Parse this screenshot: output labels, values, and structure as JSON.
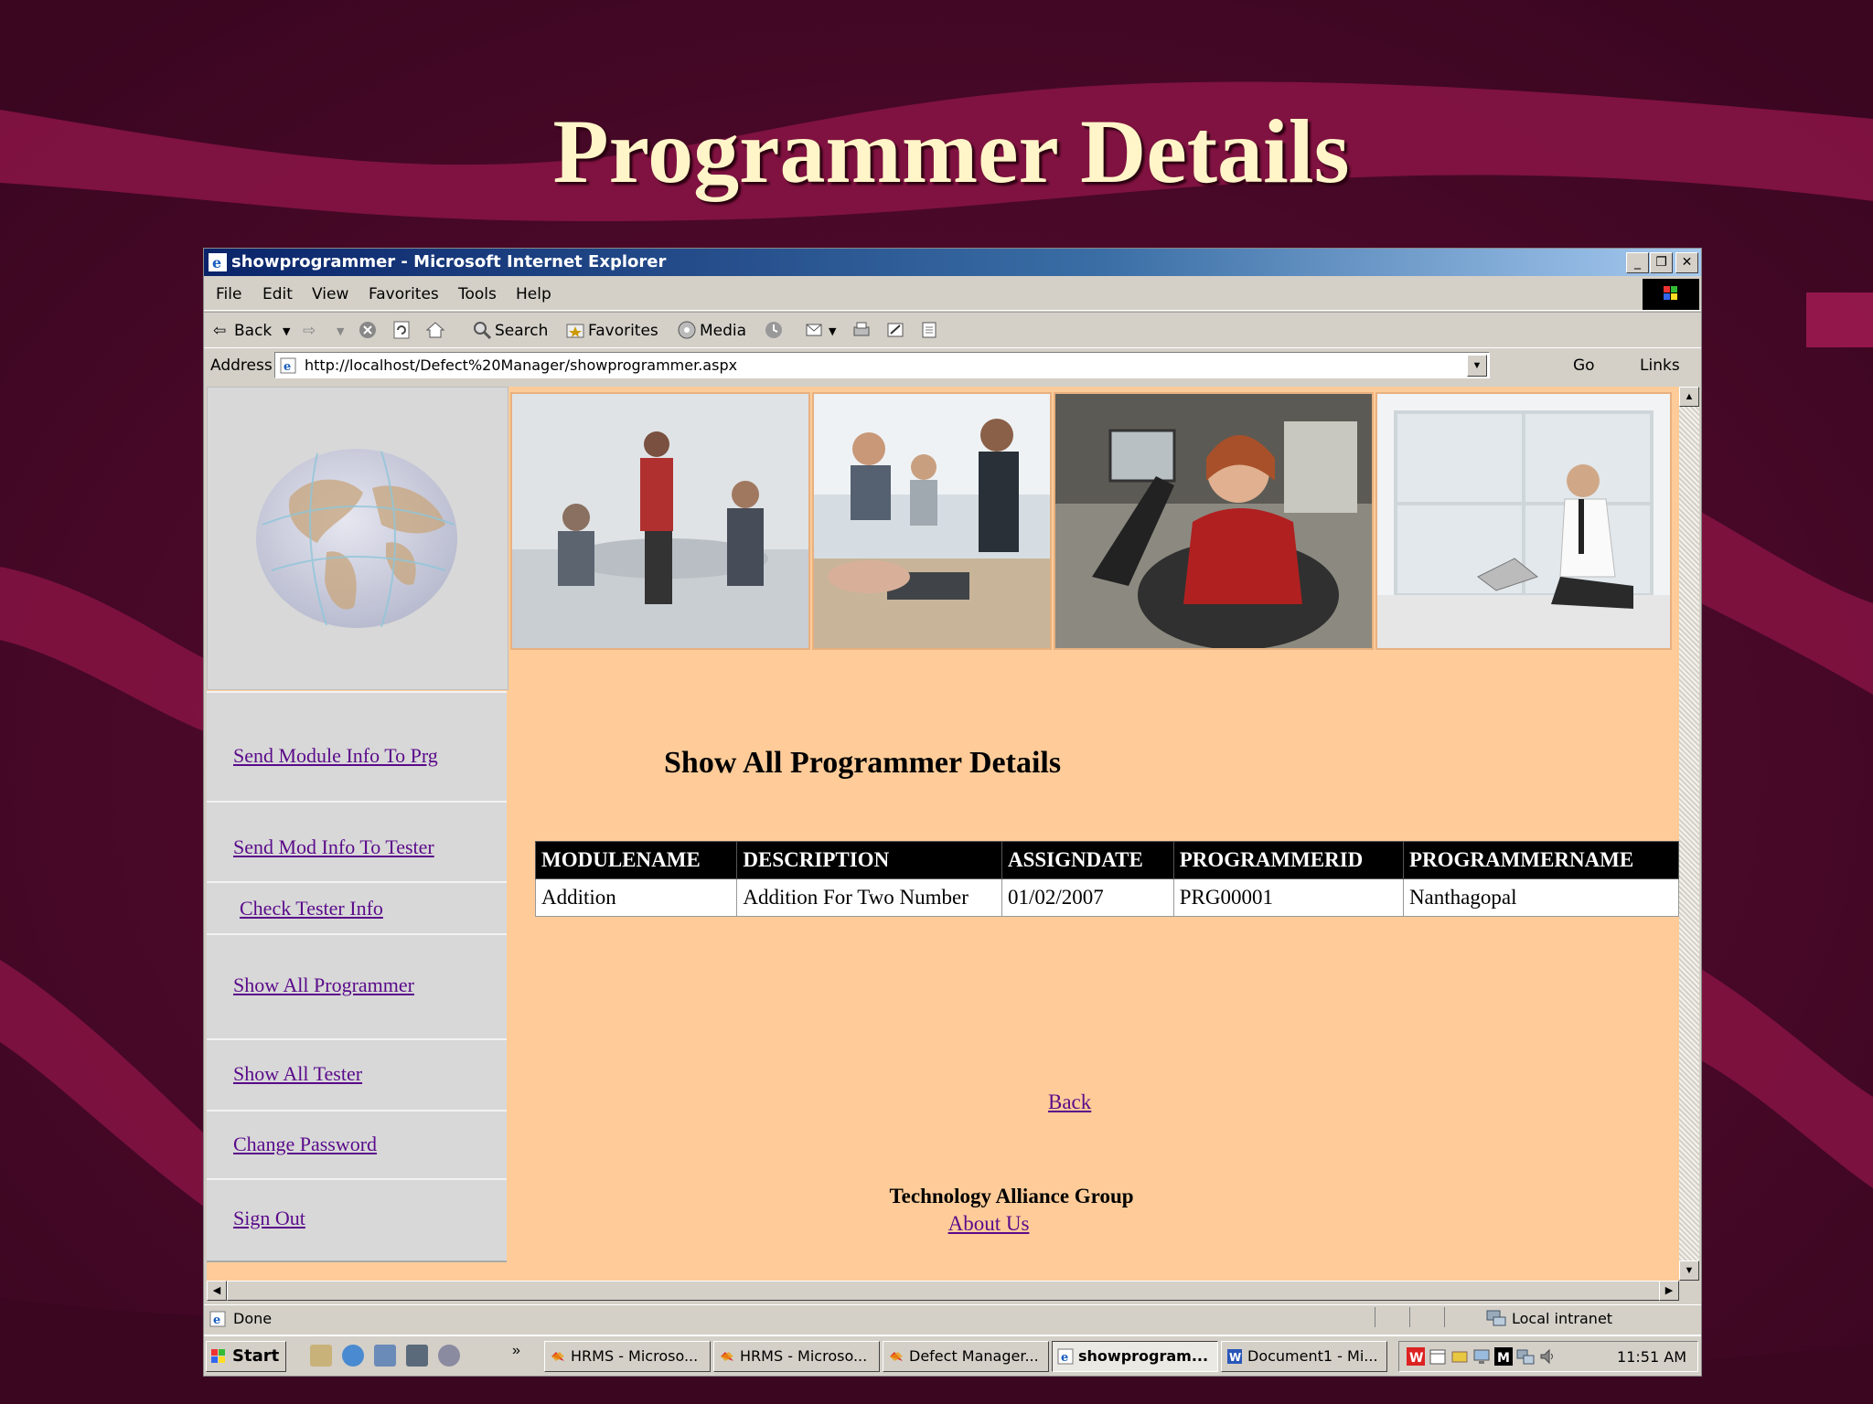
{
  "slide": {
    "title": "Programmer Details",
    "background_color": "#4a0a28",
    "title_color": "#fff5c8"
  },
  "window": {
    "title": "showprogrammer - Microsoft Internet Explorer",
    "controls": {
      "minimize": "_",
      "restore": "❐",
      "close": "✕"
    }
  },
  "menu": [
    "File",
    "Edit",
    "View",
    "Favorites",
    "Tools",
    "Help"
  ],
  "toolbar": {
    "back": "Back",
    "search": "Search",
    "favorites": "Favorites",
    "media": "Media"
  },
  "address": {
    "label": "Address",
    "url": "http://localhost/Defect%20Manager/showprogrammer.aspx",
    "go": "Go",
    "links": "Links"
  },
  "sidebar": {
    "items": [
      "Send Module Info To Prg",
      "Send Mod Info To Tester",
      "Check Tester Info",
      "Show All Programmer",
      "Show All Tester",
      "Change Password",
      "Sign Out"
    ]
  },
  "page": {
    "heading": "Show All Programmer Details",
    "table": {
      "columns": [
        "MODULENAME",
        "DESCRIPTION",
        "ASSIGNDATE",
        "PROGRAMMERID",
        "PROGRAMMERNAME"
      ],
      "rows": [
        [
          "Addition",
          "Addition For Two Number",
          "01/02/2007",
          "PRG00001",
          "Nanthagopal"
        ]
      ]
    },
    "back_link": "Back",
    "footer_org": "Technology Alliance Group",
    "footer_about": "About Us",
    "content_bg": "#ffcc99",
    "link_color": "#5a0a8a"
  },
  "status": {
    "text": "Done",
    "zone": "Local intranet"
  },
  "taskbar": {
    "start": "Start",
    "tasks": [
      "HRMS - Microso...",
      "HRMS - Microso...",
      "Defect Manager...",
      "showprogram...",
      "Document1 - Mi..."
    ],
    "active_task_index": 3,
    "clock": "11:51 AM"
  }
}
